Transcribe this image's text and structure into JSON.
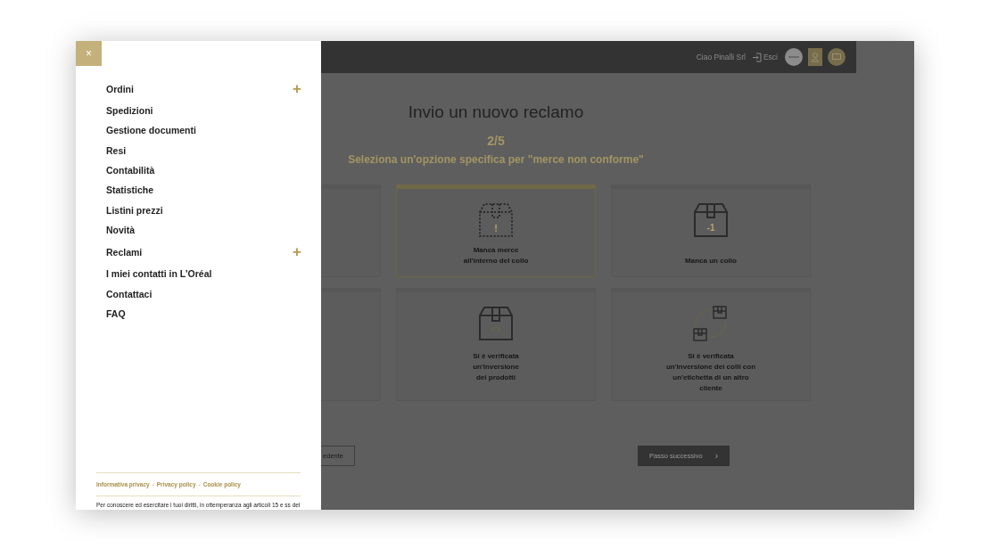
{
  "drawer": {
    "close_label": "×",
    "menu": [
      {
        "label": "Ordini",
        "kind": "group",
        "expand_icon": "+"
      },
      {
        "label": "Spedizioni",
        "kind": "link"
      },
      {
        "label": "Gestione documenti",
        "kind": "link"
      },
      {
        "label": "Resi",
        "kind": "link"
      },
      {
        "label": "Contabilità",
        "kind": "link"
      },
      {
        "label": "Statistiche",
        "kind": "link"
      },
      {
        "label": "Listini prezzi",
        "kind": "link"
      },
      {
        "label": "Novità",
        "kind": "link"
      },
      {
        "label": "Reclami",
        "kind": "group",
        "expand_icon": "+"
      },
      {
        "label": "I miei contatti in L’Oréal",
        "kind": "link"
      },
      {
        "label": "Contattaci",
        "kind": "link"
      },
      {
        "label": "FAQ",
        "kind": "link"
      }
    ],
    "footer_links": [
      {
        "label": "Informativa privacy",
        "separator": "-"
      },
      {
        "label": "Privacy policy",
        "separator": "-"
      },
      {
        "label": "Cookie policy"
      }
    ],
    "footer_text": "Per conoscere ed esercitare i tuoi diritti, in ottemperanza agli articoli 15 e ss del"
  },
  "header": {
    "greeting": "Ciao Pinalli Srl",
    "logout": "Esci"
  },
  "page": {
    "title": "Invio un nuovo reclamo",
    "step": "2/5",
    "subtitle": "Seleziona un'opzione specifica per \"merce non conforme\"",
    "options": [
      {
        "kind": "covered",
        "selected": false
      },
      {
        "kind": "dotted-box",
        "icon_text": "!",
        "label": "Manca merce\nall'interno del collo",
        "selected": true
      },
      {
        "kind": "box-minus",
        "icon_text": "-1",
        "label": "Manca un collo",
        "selected": false
      },
      {
        "kind": "covered",
        "selected": false
      },
      {
        "kind": "box-cycle",
        "label": "Si è verificata\nun'inversione\ndei prodotti",
        "selected": false
      },
      {
        "kind": "swap-boxes",
        "label": "Si è verificata\nun'inversione dei colli con\nun'etichetta di un altro\ncliente",
        "selected": false
      }
    ],
    "prev_label": "edente",
    "next_label": "Passo successivo",
    "next_icon": "›"
  }
}
